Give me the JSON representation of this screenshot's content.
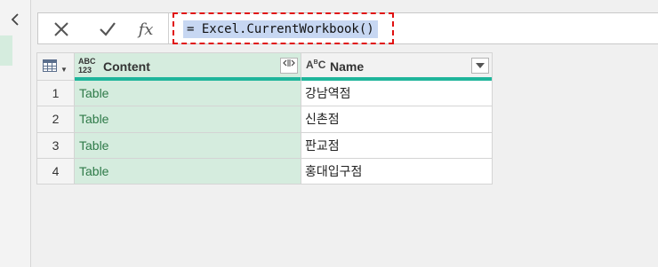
{
  "formula_bar": {
    "formula": "= Excel.CurrentWorkbook()",
    "fx_label": "fx"
  },
  "table": {
    "columns": [
      {
        "type": "ABC\n123",
        "label": "Content"
      },
      {
        "type": "ABC",
        "label": "Name"
      }
    ],
    "rows": [
      {
        "num": "1",
        "content": "Table",
        "name": "강남역점"
      },
      {
        "num": "2",
        "content": "Table",
        "name": "신촌점"
      },
      {
        "num": "3",
        "content": "Table",
        "name": "판교점"
      },
      {
        "num": "4",
        "content": "Table",
        "name": "홍대입구점"
      }
    ]
  },
  "colors": {
    "selected_column": "#d5ecde",
    "column_quality_bar": "#1fb59b",
    "highlight_border": "#e01010",
    "formula_selection": "#c7d7f2"
  }
}
